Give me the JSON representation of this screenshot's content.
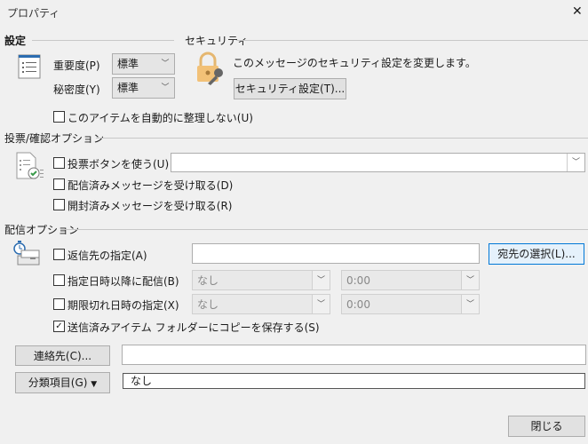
{
  "window": {
    "title": "プロパティ",
    "close": "✕"
  },
  "settings": {
    "heading": "設定",
    "importance_label": "重要度(P)",
    "importance_value": "標準",
    "sensitivity_label": "秘密度(Y)",
    "sensitivity_value": "標準",
    "no_autoarchive": "このアイテムを自動的に整理しない(U)"
  },
  "security": {
    "heading": "セキュリティ",
    "description": "このメッセージのセキュリティ設定を変更します。",
    "button": "セキュリティ設定(T)..."
  },
  "voting": {
    "heading": "投票/確認オプション",
    "use_voting": "投票ボタンを使う(U)",
    "voting_value": "",
    "delivery_receipt": "配信済みメッセージを受け取る(D)",
    "read_receipt": "開封済みメッセージを受け取る(R)"
  },
  "delivery": {
    "heading": "配信オプション",
    "reply_to": "返信先の指定(A)",
    "reply_to_value": "",
    "select_names": "宛先の選択(L)...",
    "defer": "指定日時以降に配信(B)",
    "defer_date": "なし",
    "defer_time": "0:00",
    "expire": "期限切れ日時の指定(X)",
    "expire_date": "なし",
    "expire_time": "0:00",
    "save_copy": "送信済みアイテム フォルダーにコピーを保存する(S)",
    "save_copy_checked": true
  },
  "contacts": {
    "button": "連絡先(C)...",
    "value": ""
  },
  "categories": {
    "button": "分類項目(G)",
    "value": "なし"
  },
  "footer": {
    "close": "閉じる"
  }
}
